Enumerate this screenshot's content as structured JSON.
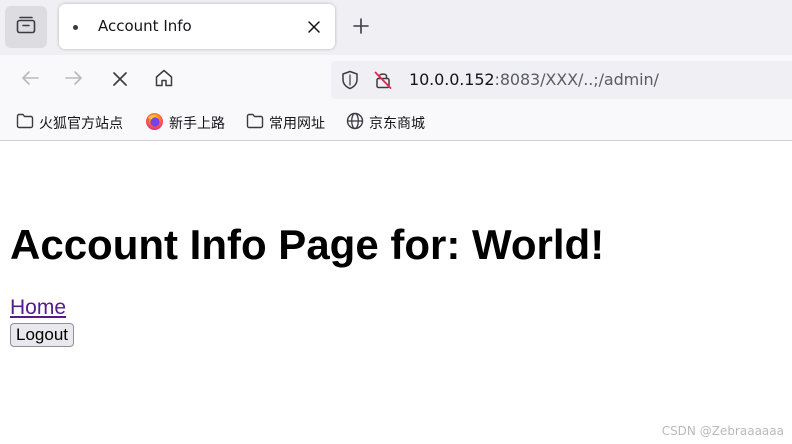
{
  "tab": {
    "title": "Account Info"
  },
  "toolbar": {
    "url_host": "10.0.0.152",
    "url_rest": ":8083/XXX/..;/admin/"
  },
  "bookmarks": [
    {
      "label": "火狐官方站点",
      "icon": "folder-icon"
    },
    {
      "label": "新手上路",
      "icon": "firefox-icon"
    },
    {
      "label": "常用网址",
      "icon": "folder-icon"
    },
    {
      "label": "京东商城",
      "icon": "globe-icon"
    }
  ],
  "page": {
    "heading": "Account Info Page for: World!",
    "home_link": "Home",
    "logout_button": "Logout"
  },
  "watermark": "CSDN @Zebraaaaaa",
  "colors": {
    "tab_strip": "#f0f0f4",
    "toolbar": "#f9f9fb",
    "visited_link": "#551a8b",
    "button_bg": "#e9e9ed"
  }
}
